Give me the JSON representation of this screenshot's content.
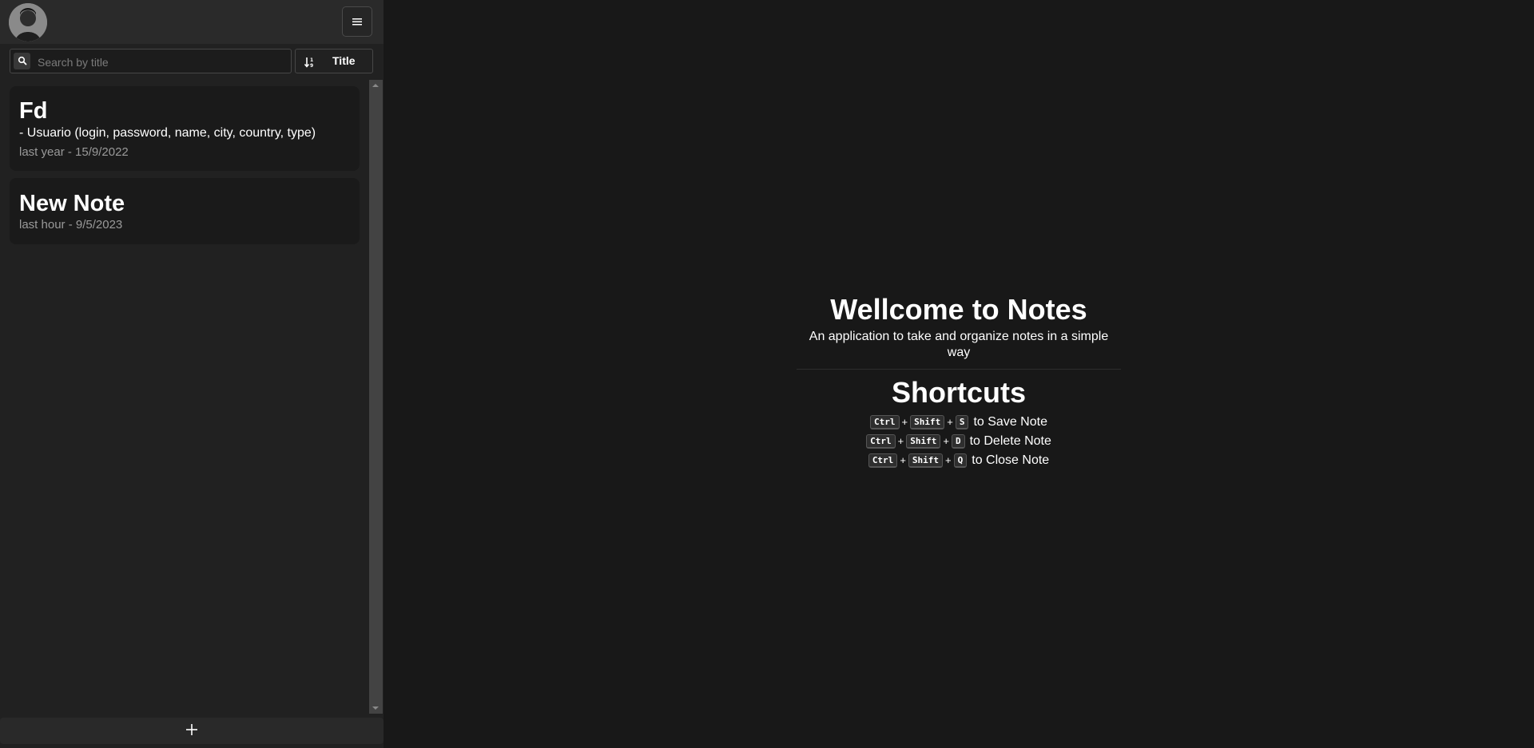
{
  "search": {
    "placeholder": "Search by title"
  },
  "sort": {
    "label": "Title",
    "icon": "sort-descending-icon"
  },
  "notes": [
    {
      "title": "Fd",
      "preview": "- Usuario (login, password, name, city, country, type)",
      "date": "last year - 15/9/2022"
    },
    {
      "title": "New Note",
      "preview": "",
      "date": "last hour - 9/5/2023"
    }
  ],
  "welcome": {
    "title": "Wellcome to Notes",
    "subtitle": "An application to take and organize notes in a simple way"
  },
  "shortcuts": {
    "title": "Shortcuts",
    "plus": "+",
    "items": [
      {
        "keys": [
          "Ctrl",
          "Shift",
          "S"
        ],
        "action": "to Save Note"
      },
      {
        "keys": [
          "Ctrl",
          "Shift",
          "D"
        ],
        "action": "to Delete Note"
      },
      {
        "keys": [
          "Ctrl",
          "Shift",
          "Q"
        ],
        "action": "to Close Note"
      }
    ]
  },
  "icons": {
    "menu": "hamburger-menu-icon",
    "search": "search-icon",
    "add": "plus-icon",
    "avatar": "user-avatar"
  },
  "colors": {
    "background": "#181818",
    "sidebar": "#212121",
    "card": "#1a1a1a",
    "muted_text": "#9a9a9a"
  }
}
